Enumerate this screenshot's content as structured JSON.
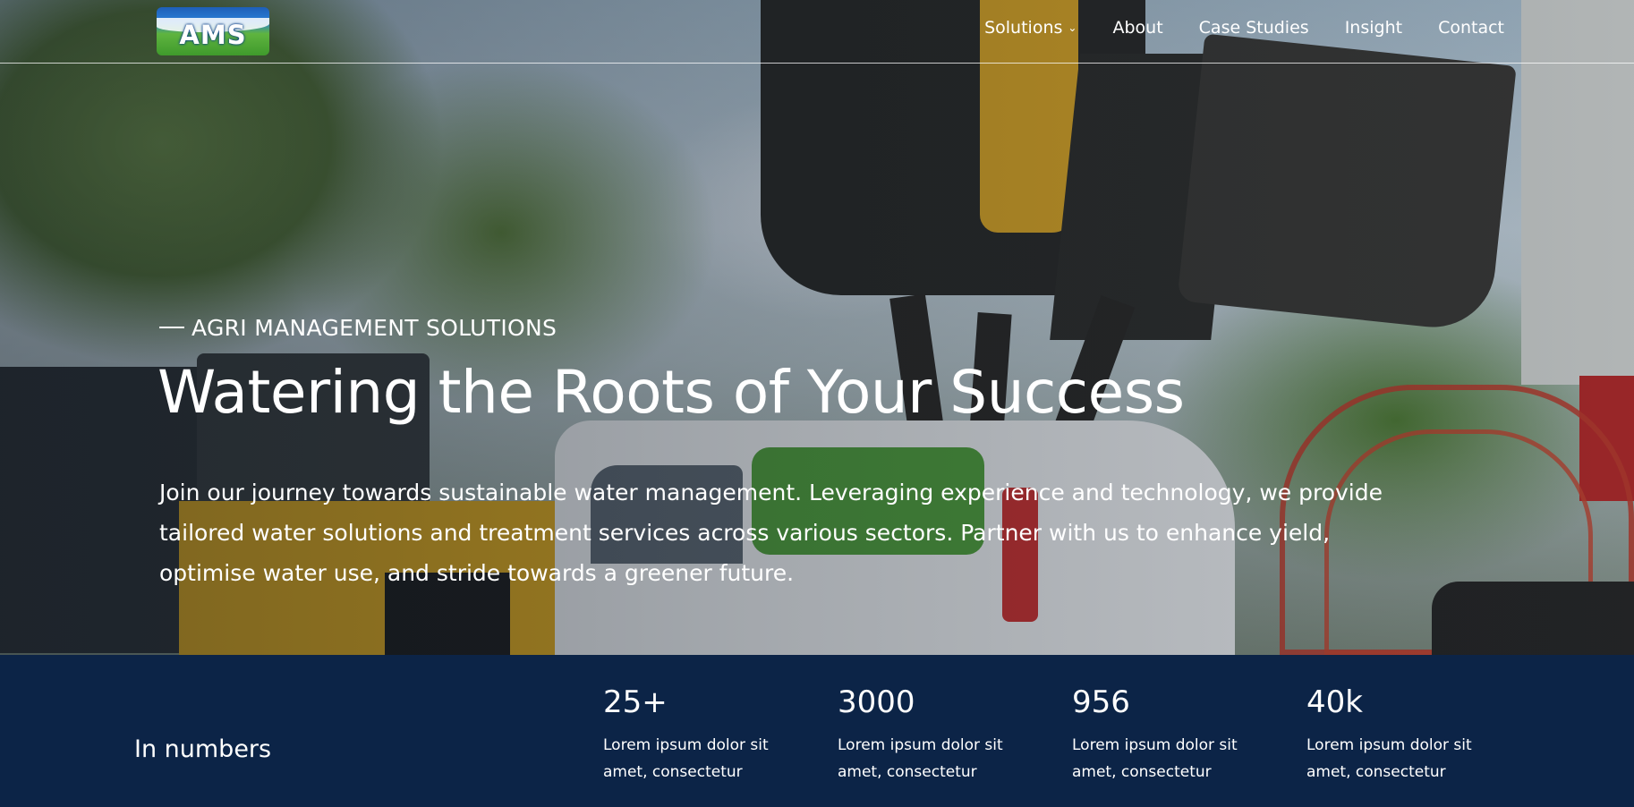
{
  "header": {
    "logo_text": "AMS",
    "nav": [
      {
        "label": "Solutions",
        "has_dropdown": true
      },
      {
        "label": "About"
      },
      {
        "label": "Case Studies"
      },
      {
        "label": "Insight"
      },
      {
        "label": "Contact"
      }
    ]
  },
  "hero": {
    "eyebrow": "AGRI MANAGEMENT SOLUTIONS",
    "title": "Watering the Roots of Your Success",
    "body": "Join our journey towards sustainable water management. Leveraging experience and technology, we provide tailored water solutions and treatment services across various sectors. Partner with us to enhance yield, optimise water use, and stride towards a greener future."
  },
  "numbers": {
    "title": "In numbers",
    "stats": [
      {
        "value": "25+",
        "desc": "Lorem ipsum dolor sit amet, consectetur"
      },
      {
        "value": "3000",
        "desc": "Lorem ipsum dolor sit amet, consectetur"
      },
      {
        "value": "956",
        "desc": "Lorem ipsum dolor sit amet, consectetur"
      },
      {
        "value": "40k",
        "desc": "Lorem ipsum dolor sit amet, consectetur"
      }
    ]
  },
  "colors": {
    "band_background": "#0c2447",
    "text": "#ffffff"
  }
}
